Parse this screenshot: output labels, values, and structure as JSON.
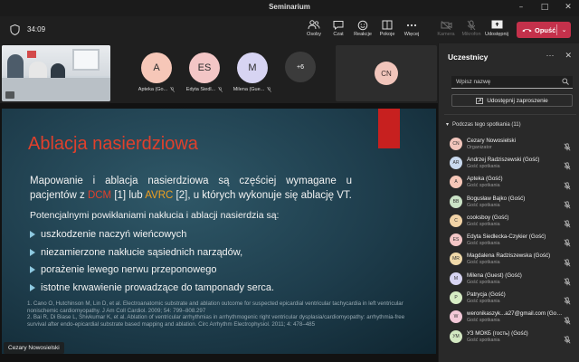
{
  "window": {
    "title": "Seminarium"
  },
  "toolbar": {
    "timer": "34:09",
    "buttons": [
      {
        "label": "Osoby",
        "icon": "people-icon"
      },
      {
        "label": "Czat",
        "icon": "chat-icon"
      },
      {
        "label": "Reakcje",
        "icon": "reactions-icon"
      },
      {
        "label": "Pokoje",
        "icon": "rooms-icon"
      },
      {
        "label": "Więcej",
        "icon": "more-icon"
      },
      {
        "label": "Kamera",
        "icon": "camera-off-icon",
        "disabled": true
      },
      {
        "label": "Mikrofon",
        "icon": "mic-off-icon",
        "disabled": true
      },
      {
        "label": "Udostępnij",
        "icon": "share-icon"
      }
    ],
    "leave_label": "Opuść"
  },
  "videos": {
    "tiles": [
      {
        "initials": "A",
        "name": "Apteka (Go...",
        "color": "#f6c7b8"
      },
      {
        "initials": "ES",
        "name": "Edyta Siedl...",
        "color": "#f3c6c6"
      },
      {
        "initials": "M",
        "name": "Milena (Gue...",
        "color": "#d7d4f2"
      }
    ],
    "more_count": "+6",
    "self_initials": "CN"
  },
  "slide": {
    "title": "Ablacja nasierdziowa",
    "para_a": "Mapowanie i ablacja nasierdziowa są częściej wymagane u pacjentów z ",
    "hl_dcm": "DCM",
    "para_b": " [1] lub ",
    "hl_avrc": "AVRC",
    "para_c": " [2], u których wykonuje się ablację VT.",
    "intro": "Potencjalnymi powikłaniami nakłucia i ablacji nasierdzia są:",
    "bullets": [
      "uszkodzenie naczyń wieńcowych",
      "niezamierzone nakłucie sąsiednich narządów,",
      "porażenie lewego nerwu przeponowego",
      "istotne krwawienie prowadzące do tamponady serca."
    ],
    "refs": [
      "1. Cano O, Hutchinson M, Lin D, et al. Electroanatomic substrate and ablation outcome for suspected epicardial ventricular tachycardia in left ventricular nonischemic cardiomyopathy. J Am Coll Cardiol. 2009; 54: 799–808.297",
      "2. Bai R, Di Biase L, Shivkumar K, et al. Ablation of ventricular arrhythmias in arrhythmogenic right ventricular dysplasia/cardiomyopathy: arrhythmia-free survival after endo-epicardial substrate based mapping and ablation. Circ Arrhythm Electrophysiol. 2011; 4: 478–485"
    ],
    "presenter": "Cezary Nowosielski"
  },
  "panel": {
    "title": "Uczestnicy",
    "search_placeholder": "Wpisz nazwę",
    "share_label": "Udostępnij zaproszenie",
    "section_label": "Podczas tego spotkania (11)",
    "participants": [
      {
        "initials": "CN",
        "name": "Cezary Nowosielski",
        "role": "Organizator",
        "color": "#f1c5bb"
      },
      {
        "initials": "AR",
        "name": "Andrzej Radziszewski (Gość)",
        "role": "Gość spotkania",
        "color": "#c9d9ee"
      },
      {
        "initials": "A",
        "name": "Apteka (Gość)",
        "role": "Gość spotkania",
        "color": "#f6c7b8"
      },
      {
        "initials": "BB",
        "name": "Bogusław Bajko (Gość)",
        "role": "Gość spotkania",
        "color": "#cbe3c6"
      },
      {
        "initials": "C",
        "name": "cooksboy (Gość)",
        "role": "Gość spotkania",
        "color": "#f2d3a6"
      },
      {
        "initials": "ES",
        "name": "Edyta Siedlecka-Czykier (Gość)",
        "role": "Gość spotkania",
        "color": "#f3c6c6"
      },
      {
        "initials": "MR",
        "name": "Magdalena Radziszewska (Gość)",
        "role": "Gość spotkania",
        "color": "#f0d9a9"
      },
      {
        "initials": "M",
        "name": "Milena (Guest) (Gość)",
        "role": "Gość spotkania",
        "color": "#d7d4f2"
      },
      {
        "initials": "P",
        "name": "Patrycja (Gość)",
        "role": "Gość spotkania",
        "color": "#d6ecc4"
      },
      {
        "initials": "W",
        "name": "weronikaszyk...a27@gmail.com (Gość)",
        "role": "Gość spotkania",
        "color": "#f3c8d8"
      },
      {
        "initials": "УМ",
        "name": "УЗ МОКБ (гость) (Gość)",
        "role": "Gość spotkania",
        "color": "#d3e8c2"
      }
    ]
  },
  "colors": {
    "accent_red": "#c4314b",
    "slide_title": "#e0402c"
  }
}
